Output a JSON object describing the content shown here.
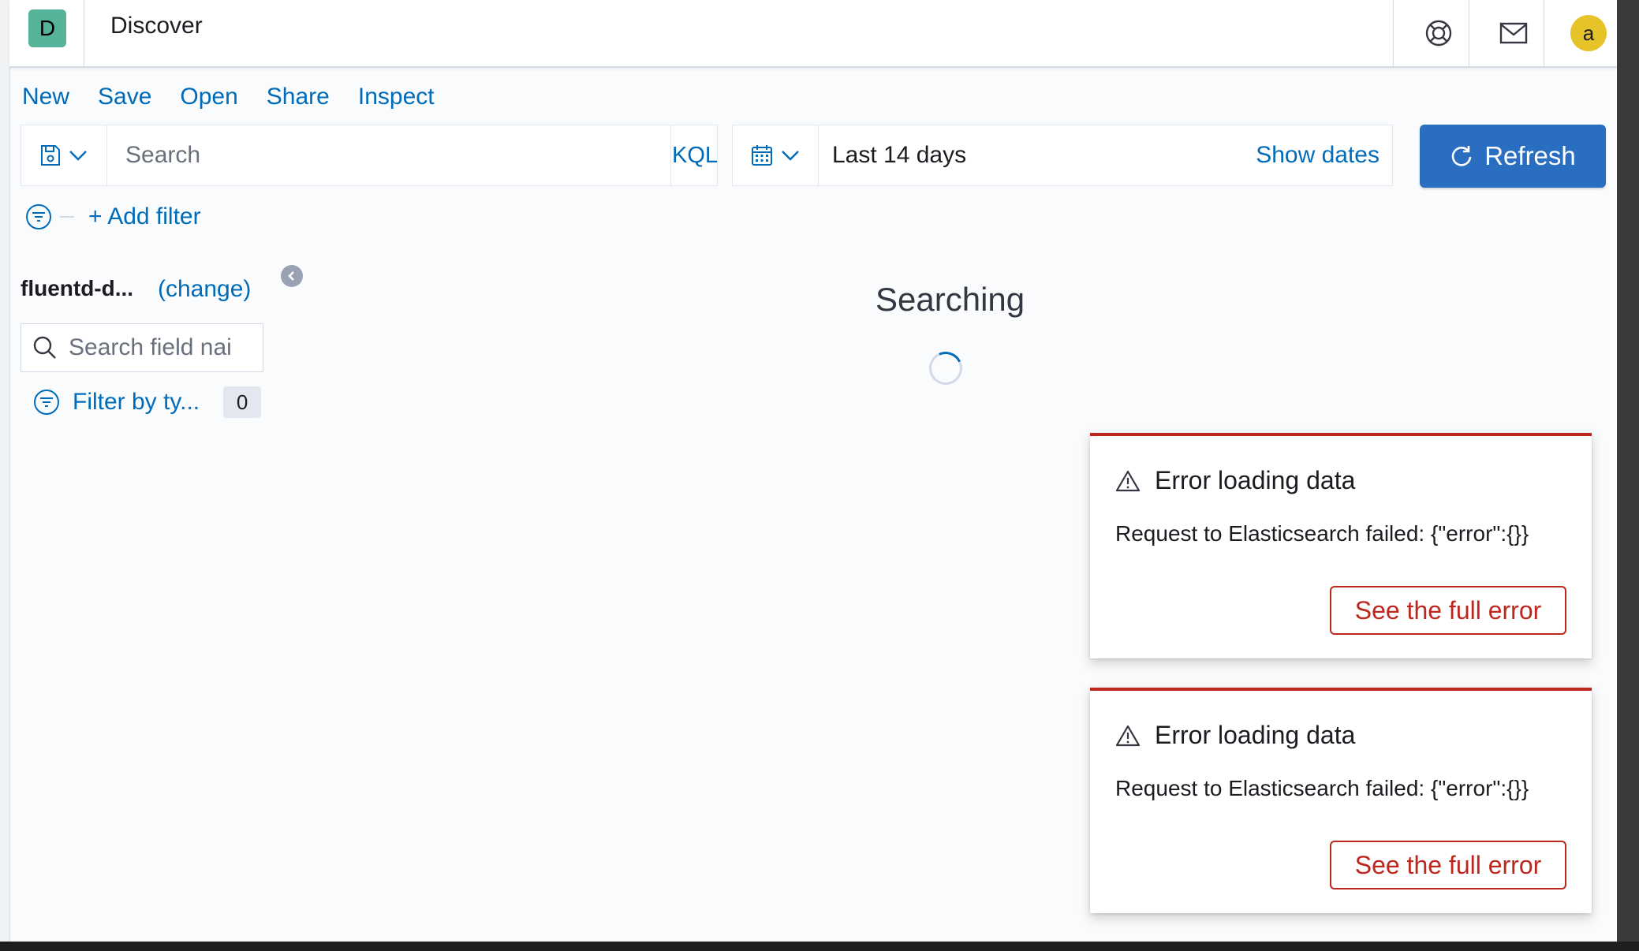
{
  "header": {
    "logo_letter": "D",
    "title": "Discover",
    "avatar_letter": "a",
    "icons": [
      "help-icon",
      "newsfeed-icon",
      "avatar"
    ]
  },
  "menu": {
    "items": [
      "New",
      "Save",
      "Open",
      "Share",
      "Inspect"
    ]
  },
  "query": {
    "placeholder": "Search",
    "language": "KQL"
  },
  "date": {
    "range": "Last 14 days",
    "show_dates": "Show dates"
  },
  "refresh_label": "Refresh",
  "filters": {
    "add_label": "+ Add filter"
  },
  "sidebar": {
    "index_pattern": "fluentd-d...",
    "change_label": "(change)",
    "field_search_placeholder": "Search field nai",
    "filter_by_type": "Filter by ty...",
    "filter_count": "0"
  },
  "main": {
    "status": "Searching"
  },
  "toasts": [
    {
      "title": "Error loading data",
      "body": "Request to Elasticsearch failed: {\"error\":{}}",
      "button": "See the full error"
    },
    {
      "title": "Error loading data",
      "body": "Request to Elasticsearch failed: {\"error\":{}}",
      "button": "See the full error"
    }
  ],
  "colors": {
    "accent": "#006bb8",
    "primary_button": "#2a6ec2",
    "danger": "#bd271e",
    "logo": "#54b399",
    "avatar": "#e7c32a"
  }
}
